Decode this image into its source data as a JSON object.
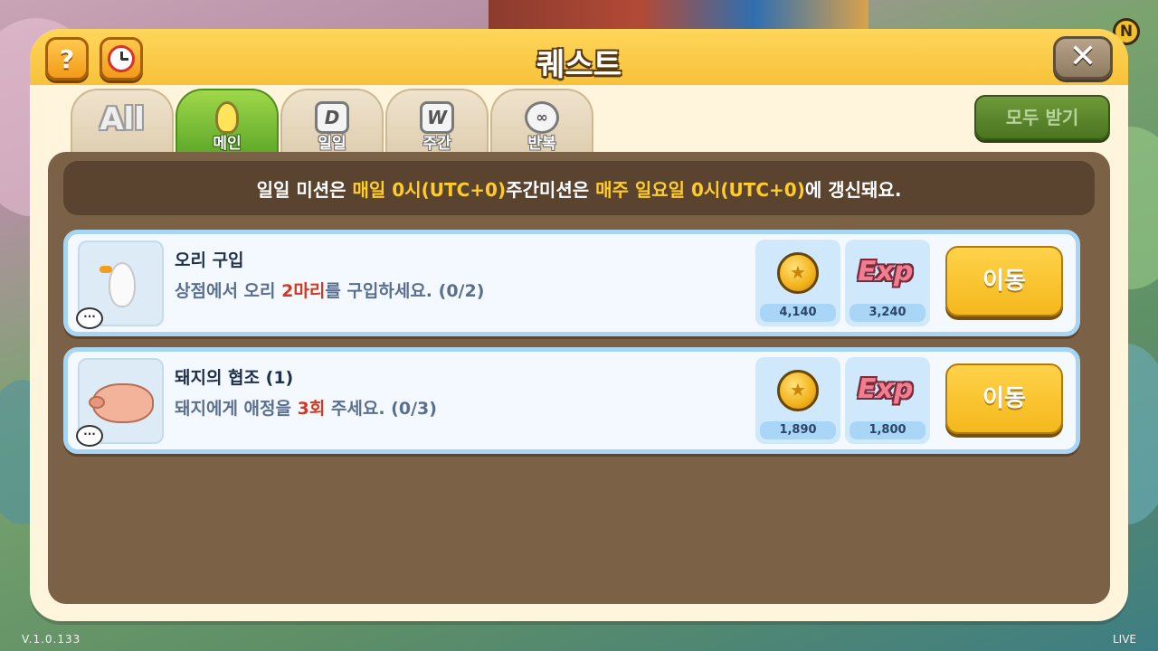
{
  "app": {
    "version": "V.1.0.133",
    "live_label": "LIVE",
    "n_badge": "N"
  },
  "dialog": {
    "title": "퀘스트",
    "help_label": "?",
    "close_label": "✕",
    "claim_all_label": "모두 받기"
  },
  "tabs": [
    {
      "icon_text": "All",
      "label": "",
      "icon": "all-icon",
      "active": false
    },
    {
      "icon_text": "",
      "label": "메인",
      "icon": "lightbulb-icon",
      "active": true
    },
    {
      "icon_text": "D",
      "label": "일일",
      "icon": "daily-icon",
      "active": false
    },
    {
      "icon_text": "W",
      "label": "주간",
      "icon": "weekly-icon",
      "active": false
    },
    {
      "icon_text": "∞",
      "label": "반복",
      "icon": "repeat-icon",
      "active": false
    }
  ],
  "notice": {
    "part1": "일일 미션은 ",
    "hl1": "매일 0시(UTC+0)",
    "part2": " 주간미션은 ",
    "hl2": "매주 일요일 0시(UTC+0)",
    "part3": "에 갱신돼요."
  },
  "quests": [
    {
      "name": "오리 구입",
      "desc_pre": "상점에서 오리 ",
      "desc_hl": "2마리",
      "desc_post": "를 구입하세요. (0/2)",
      "coin_reward": "4,140",
      "exp_reward": "3,240",
      "exp_label": "Exp",
      "button": "이동",
      "animal": "duck"
    },
    {
      "name": "돼지의 협조 (1)",
      "desc_pre": "돼지에게 애정을 ",
      "desc_hl": "3회",
      "desc_post": " 주세요. (0/3)",
      "coin_reward": "1,890",
      "exp_reward": "1,800",
      "exp_label": "Exp",
      "button": "이동",
      "animal": "pig"
    }
  ],
  "colors": {
    "title_bar": "#f7c23a",
    "active_tab": "#5fa82a",
    "panel": "#7b6145",
    "highlight": "#ffcc2a",
    "quest_highlight": "#d4381e",
    "move_button": "#f4b81c"
  }
}
